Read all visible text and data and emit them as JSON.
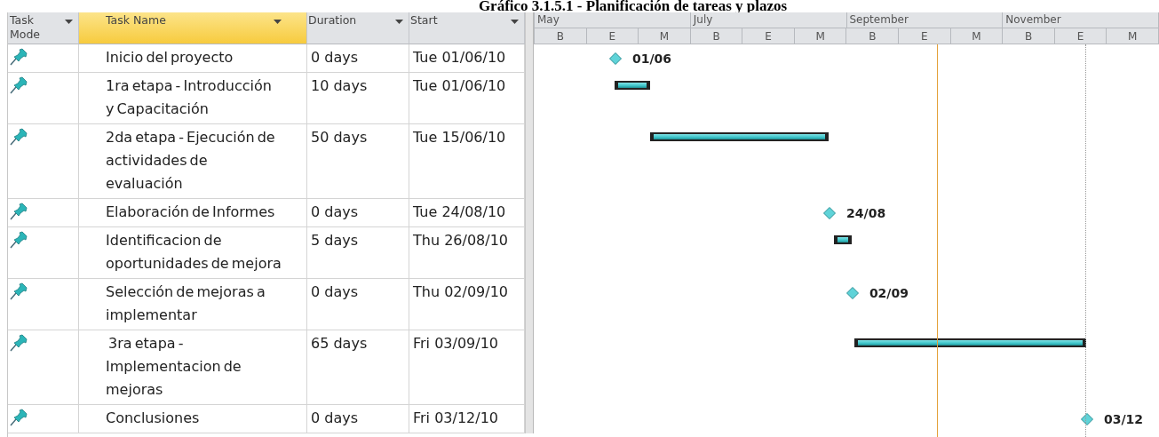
{
  "title": "Gráfico 3.1.5.1 - Planificación de tareas y plazos",
  "columns": [
    {
      "label": "Task Mode",
      "selected": false
    },
    {
      "label": "Task Name",
      "selected": true
    },
    {
      "label": "Duration",
      "selected": false
    },
    {
      "label": "Start",
      "selected": false
    }
  ],
  "timescale": {
    "months": [
      "May",
      "July",
      "September",
      "November"
    ],
    "thirds": [
      "B",
      "E",
      "M",
      "B",
      "E",
      "M",
      "B",
      "E",
      "M",
      "B",
      "E",
      "M"
    ]
  },
  "rows": [
    {
      "name": "Inicio del proyecto",
      "duration": "0 days",
      "start": "Tue 01/06/10",
      "gantt": {
        "kind": "milestone",
        "label": "01/06"
      }
    },
    {
      "name": "1ra etapa - Introducción y Capacitación",
      "duration": "10 days",
      "start": "Tue 01/06/10",
      "gantt": {
        "kind": "task"
      }
    },
    {
      "name": "2da etapa - Ejecución de actividades de evaluación",
      "duration": "50 days",
      "start": "Tue 15/06/10",
      "gantt": {
        "kind": "task"
      }
    },
    {
      "name": "Elaboración de Informes",
      "duration": "0 days",
      "start": "Tue 24/08/10",
      "gantt": {
        "kind": "milestone",
        "label": "24/08"
      }
    },
    {
      "name": "Identificacion de oportunidades de mejora",
      "duration": "5 days",
      "start": "Thu 26/08/10",
      "gantt": {
        "kind": "task"
      }
    },
    {
      "name": "Selección de mejoras a implementar",
      "duration": "0 days",
      "start": "Thu 02/09/10",
      "gantt": {
        "kind": "milestone",
        "label": "02/09"
      }
    },
    {
      "name": " 3ra etapa - Implementacion de mejoras",
      "duration": "65 days",
      "start": "Fri 03/09/10",
      "gantt": {
        "kind": "task"
      }
    },
    {
      "name": "Conclusiones",
      "duration": "0 days",
      "start": "Fri 03/12/10",
      "gantt": {
        "kind": "milestone",
        "label": "03/12"
      }
    }
  ]
}
